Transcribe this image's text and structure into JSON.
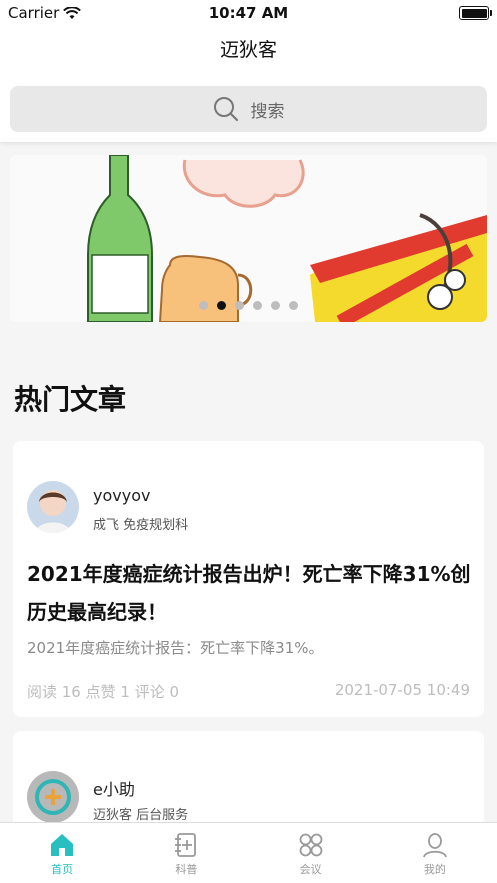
{
  "status_bar": {
    "carrier": "Carrier",
    "time": "10:47 AM"
  },
  "nav": {
    "title": "迈狄客"
  },
  "search": {
    "placeholder": "搜索"
  },
  "banner": {
    "dots_total": 6,
    "active_dot": 1
  },
  "section": {
    "title": "热门文章"
  },
  "articles": [
    {
      "author": "yovyov",
      "org": "成飞 免疫规划科",
      "title": "2021年度癌症统计报告出炉！死亡率下降31%创历史最高纪录！",
      "summary": "2021年度癌症统计报告：死亡率下降31%。",
      "stats": "阅读 16 点赞 1 评论 0",
      "date": "2021-07-05 10:49"
    },
    {
      "author": "e小助",
      "org": "迈狄客 后台服务"
    }
  ],
  "tabs": [
    {
      "label": "首页",
      "icon": "home-icon",
      "active": true
    },
    {
      "label": "科普",
      "icon": "notebook-icon",
      "active": false
    },
    {
      "label": "会议",
      "icon": "grid-icon",
      "active": false
    },
    {
      "label": "我的",
      "icon": "person-icon",
      "active": false
    }
  ],
  "colors": {
    "accent": "#27bfbf",
    "background": "#f5f5f5"
  }
}
